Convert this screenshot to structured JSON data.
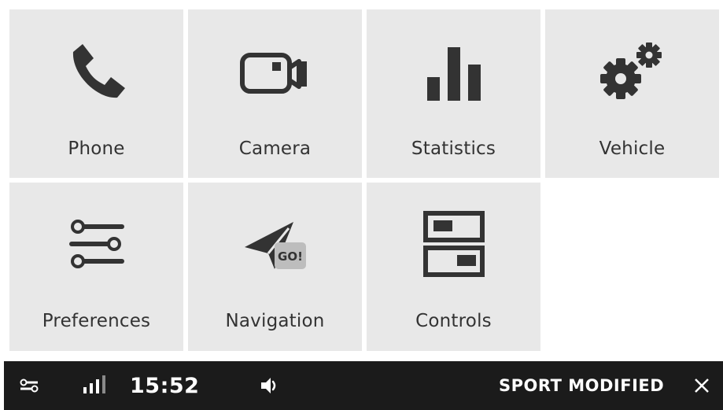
{
  "tiles": [
    {
      "label": "Phone",
      "icon": "phone-icon"
    },
    {
      "label": "Camera",
      "icon": "camera-icon"
    },
    {
      "label": "Statistics",
      "icon": "bar-chart-icon"
    },
    {
      "label": "Vehicle",
      "icon": "gears-icon"
    },
    {
      "label": "Preferences",
      "icon": "sliders-icon"
    },
    {
      "label": "Navigation",
      "icon": "paper-plane-go-icon"
    },
    {
      "label": "Controls",
      "icon": "toggle-switches-icon"
    }
  ],
  "status_bar": {
    "time": "15:52",
    "mode": "SPORT MODIFIED",
    "icons": [
      "settings-sliders-icon",
      "signal-strength-icon",
      "volume-icon",
      "close-icon"
    ]
  },
  "colors": {
    "tile_background": "#e8e8e8",
    "icon": "#333333",
    "status_bar_background": "#1b1b1b",
    "status_bar_text": "#ffffff"
  }
}
